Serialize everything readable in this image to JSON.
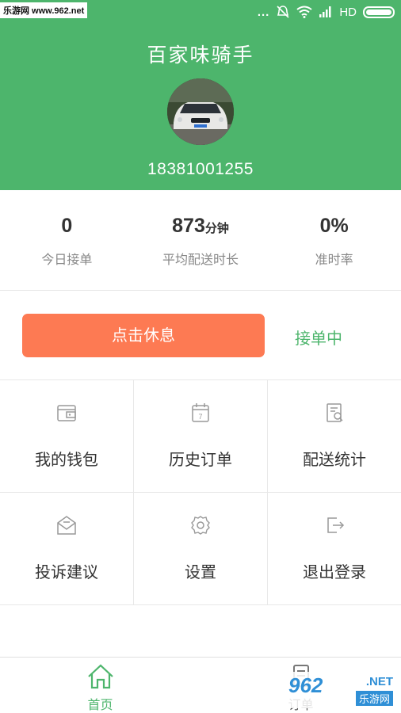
{
  "status_bar": {
    "watermark": "乐游网 www.962.net",
    "signal_dots": "...",
    "network": "HD",
    "icons": [
      "silent-icon",
      "wifi-icon",
      "signal-icon",
      "battery-icon"
    ]
  },
  "header": {
    "title": "百家味骑手",
    "phone": "18381001255",
    "avatar_alt": "avatar-car"
  },
  "stats": [
    {
      "value": "0",
      "unit": "",
      "label": "今日接单"
    },
    {
      "value": "873",
      "unit": "分钟",
      "label": "平均配送时长"
    },
    {
      "value": "0%",
      "unit": "",
      "label": "准时率"
    }
  ],
  "action": {
    "rest_button": "点击休息",
    "status": "接单中"
  },
  "menu": [
    {
      "label": "我的钱包",
      "icon": "wallet-icon"
    },
    {
      "label": "历史订单",
      "icon": "calendar-icon"
    },
    {
      "label": "配送统计",
      "icon": "stats-doc-icon"
    },
    {
      "label": "投诉建议",
      "icon": "mail-icon"
    },
    {
      "label": "设置",
      "icon": "gear-icon"
    },
    {
      "label": "退出登录",
      "icon": "logout-icon"
    }
  ],
  "tabs": [
    {
      "label": "首页",
      "icon": "home-icon",
      "active": true
    },
    {
      "label": "订单",
      "icon": "order-icon",
      "active": false
    }
  ],
  "watermark_br": {
    "num": "962",
    "net": ".NET",
    "cn": "乐游网"
  },
  "colors": {
    "primary_green": "#4db56c",
    "rest_orange": "#fd7a53",
    "divider": "#e8e8e8",
    "icon_gray": "#999999"
  }
}
